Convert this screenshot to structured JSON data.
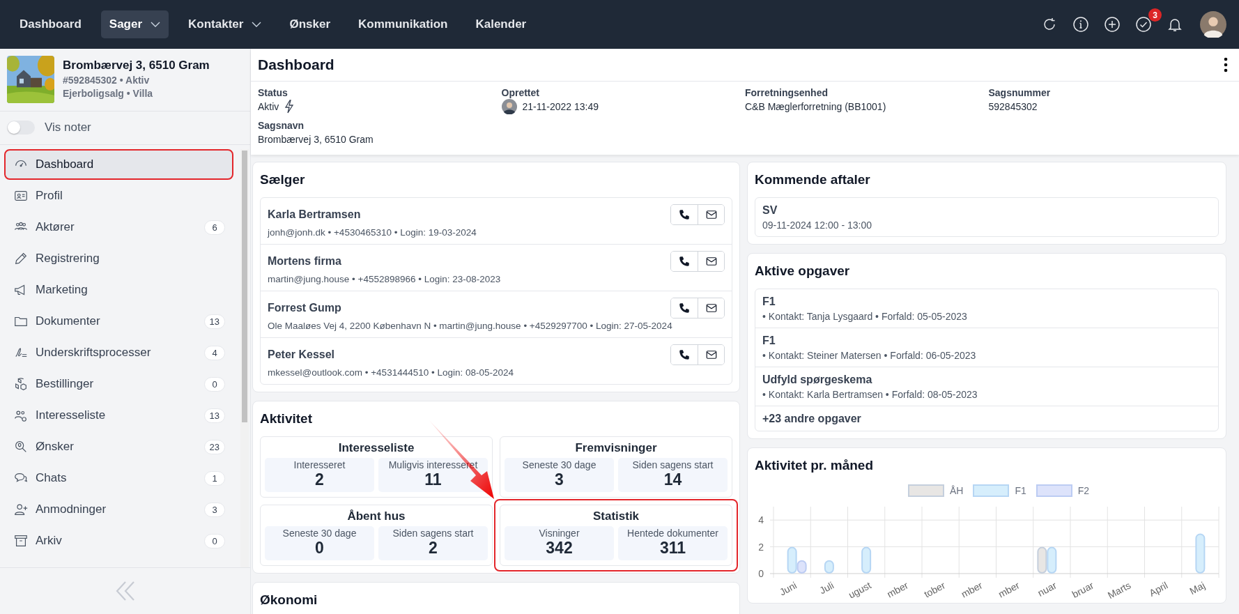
{
  "nav": {
    "items": [
      {
        "label": "Dashboard",
        "selected": false,
        "dropdown": false
      },
      {
        "label": "Sager",
        "selected": true,
        "dropdown": true
      },
      {
        "label": "Kontakter",
        "selected": false,
        "dropdown": true
      },
      {
        "label": "Ønsker",
        "selected": false,
        "dropdown": false
      },
      {
        "label": "Kommunikation",
        "selected": false,
        "dropdown": false
      },
      {
        "label": "Kalender",
        "selected": false,
        "dropdown": false
      }
    ],
    "tasks_badge": "3"
  },
  "property": {
    "title": "Brombærvej 3, 6510 Gram",
    "line1": "#592845302 • Aktiv",
    "line2": "Ejerboligsalg • Villa"
  },
  "notes_toggle": {
    "label": "Vis noter",
    "on": false
  },
  "sidebar": {
    "items": [
      {
        "label": "Dashboard",
        "selected": true,
        "highlighted": true
      },
      {
        "label": "Profil",
        "selected": false,
        "highlighted": false
      },
      {
        "label": "Aktører",
        "badge": "6",
        "selected": false,
        "highlighted": false
      },
      {
        "label": "Registrering",
        "selected": false,
        "highlighted": false
      },
      {
        "label": "Marketing",
        "selected": false,
        "highlighted": false
      },
      {
        "label": "Dokumenter",
        "badge": "13",
        "selected": false,
        "highlighted": false
      },
      {
        "label": "Underskriftsprocesser",
        "badge": "4",
        "selected": false,
        "highlighted": false
      },
      {
        "label": "Bestillinger",
        "badge": "0",
        "selected": false,
        "highlighted": false
      },
      {
        "label": "Interesseliste",
        "badge": "13",
        "selected": false,
        "highlighted": false
      },
      {
        "label": "Ønsker",
        "badge": "23",
        "selected": false,
        "highlighted": false
      },
      {
        "label": "Chats",
        "badge": "1",
        "selected": false,
        "highlighted": false
      },
      {
        "label": "Anmodninger",
        "badge": "3",
        "selected": false,
        "highlighted": false
      },
      {
        "label": "Arkiv",
        "badge": "0",
        "selected": false,
        "highlighted": false
      }
    ]
  },
  "page": {
    "title": "Dashboard",
    "fields": [
      {
        "label": "Status",
        "value": "Aktiv",
        "kind": "status"
      },
      {
        "label": "Oprettet",
        "value": "21-11-2022 13:49",
        "kind": "user"
      },
      {
        "label": "Forretningsenhed",
        "value": "C&B Mæglerforretning (BB1001)",
        "kind": "text"
      },
      {
        "label": "Sagsnummer",
        "value": "592845302",
        "kind": "text"
      },
      {
        "label": "Sagsnavn",
        "value": "Brombærvej 3, 6510 Gram",
        "kind": "text"
      }
    ]
  },
  "sellers": {
    "title": "Sælger",
    "rows": [
      {
        "name": "Karla Bertramsen",
        "details": "jonh@jonh.dk • +4530465310 • Login: 19-03-2024"
      },
      {
        "name": "Mortens firma",
        "details": "martin@jung.house • +4552898966 • Login: 23-08-2023"
      },
      {
        "name": "Forrest Gump",
        "details": "Ole Maaløes Vej 4, 2200 København N • martin@jung.house • +4529297700 • Login: 27-05-2024"
      },
      {
        "name": "Peter Kessel",
        "details": "mkessel@outlook.com • +4531444510 • Login: 08-05-2024"
      }
    ]
  },
  "activity": {
    "title": "Aktivitet",
    "groups": [
      {
        "title": "Interesseliste",
        "highlighted": false,
        "stats": [
          {
            "label": "Interesseret",
            "value": "2"
          },
          {
            "label": "Muligvis interesseret",
            "value": "11"
          }
        ]
      },
      {
        "title": "Fremvisninger",
        "highlighted": false,
        "stats": [
          {
            "label": "Seneste 30 dage",
            "value": "3"
          },
          {
            "label": "Siden sagens start",
            "value": "14"
          }
        ]
      },
      {
        "title": "Åbent hus",
        "highlighted": false,
        "stats": [
          {
            "label": "Seneste 30 dage",
            "value": "0"
          },
          {
            "label": "Siden sagens start",
            "value": "2"
          }
        ]
      },
      {
        "title": "Statistik",
        "highlighted": true,
        "stats": [
          {
            "label": "Visninger",
            "value": "342"
          },
          {
            "label": "Hentede dokumenter",
            "value": "311"
          }
        ]
      }
    ]
  },
  "economy": {
    "title": "Økonomi"
  },
  "appointments": {
    "title": "Kommende aftaler",
    "items": [
      {
        "title": "SV",
        "time": "09-11-2024 12:00 - 13:00"
      }
    ]
  },
  "tasks": {
    "title": "Aktive opgaver",
    "items": [
      {
        "title": "F1",
        "details": "• Kontakt: Tanja Lysgaard • Forfald: 05-05-2023"
      },
      {
        "title": "F1",
        "details": "• Kontakt: Steiner Matersen • Forfald: 06-05-2023"
      },
      {
        "title": "Udfyld spørgeskema",
        "details": "• Kontakt: Karla Bertramsen • Forfald: 08-05-2023"
      }
    ],
    "more": "+23 andre opgaver"
  },
  "monthly": {
    "title": "Aktivitet pr. måned",
    "chart_data": {
      "type": "bar",
      "categories": [
        "Juni",
        "Juli",
        "ugust",
        "mber",
        "tober",
        "mber",
        "mber",
        "nuar",
        "bruar",
        "Marts",
        "April",
        "Maj"
      ],
      "series": [
        {
          "name": "ÅH",
          "color": "#e8e6e4",
          "values": [
            0,
            0,
            0,
            0,
            0,
            0,
            0,
            2,
            0,
            0,
            0,
            0
          ]
        },
        {
          "name": "F1",
          "color": "#d6eefc",
          "values": [
            2,
            1,
            2,
            0,
            0,
            0,
            0,
            2,
            0,
            0,
            0,
            3
          ]
        },
        {
          "name": "F2",
          "color": "#dde3fb",
          "values": [
            1,
            0,
            0,
            0,
            0,
            0,
            0,
            0,
            0,
            0,
            0,
            0
          ]
        }
      ],
      "ylim": [
        0,
        5
      ],
      "yticks": [
        0,
        2,
        4
      ]
    }
  }
}
